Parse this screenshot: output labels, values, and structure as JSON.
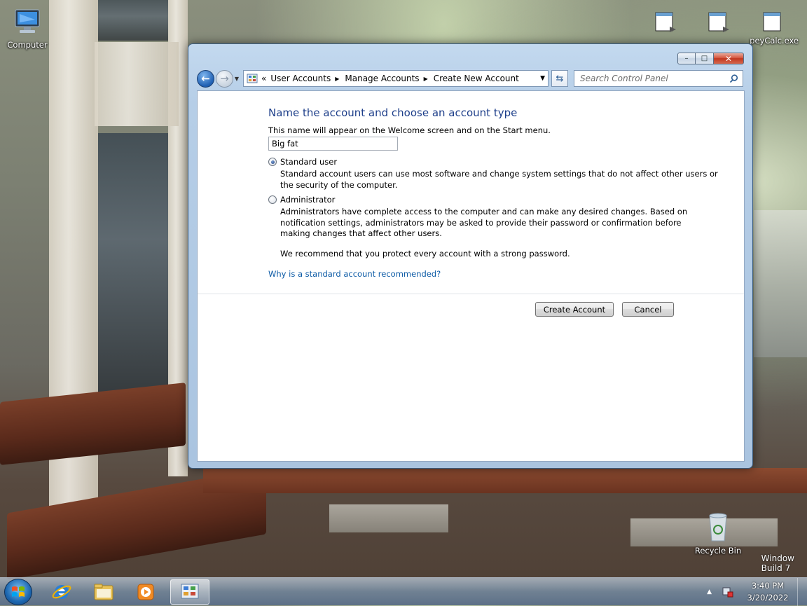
{
  "desktop": {
    "icons": [
      {
        "label": "Computer",
        "icon": "computer-icon"
      },
      {
        "label": "",
        "icon": "shortcut-icon"
      },
      {
        "label": "",
        "icon": "shortcut-icon"
      },
      {
        "label": "peyCalc.exe",
        "icon": "exe-shortcut-icon"
      },
      {
        "label": "Recycle Bin",
        "icon": "recycle-bin-icon"
      }
    ],
    "watermark_line1": "Window",
    "watermark_line2": "Build 7"
  },
  "window": {
    "title_buttons": {
      "minimize": "–",
      "maximize": "□",
      "close": "✕"
    },
    "address": {
      "overflow": "«",
      "crumbs": [
        "User Accounts",
        "Manage Accounts",
        "Create New Account"
      ]
    },
    "search": {
      "placeholder": "Search Control Panel"
    },
    "form": {
      "heading": "Name the account and choose an account type",
      "subtext": "This name will appear on the Welcome screen and on the Start menu.",
      "name_value": "Big fat",
      "options": [
        {
          "label": "Standard user",
          "checked": true,
          "description_lines": [
            "Standard account users can use most software and change system settings that do not affect other users or",
            "the security of the computer."
          ]
        },
        {
          "label": "Administrator",
          "checked": false,
          "description_lines": [
            "Administrators have complete access to the computer and can make any desired changes. Based on",
            "notification settings, administrators may be asked to provide their password or confirmation before",
            "making changes that affect other users."
          ]
        }
      ],
      "recommendation": "We recommend that you protect every account with a strong password.",
      "help_link": "Why is a standard account recommended?",
      "create_button": "Create Account",
      "cancel_button": "Cancel"
    }
  },
  "taskbar": {
    "items": [
      "internet-explorer-icon",
      "folder-icon",
      "media-player-icon",
      "control-panel-icon"
    ],
    "clock": {
      "time": "3:40 PM",
      "date": "3/20/2022"
    }
  },
  "colors": {
    "heading": "#1e3f8a",
    "link": "#0d5ba6",
    "window_frame": "#b6cee7"
  }
}
